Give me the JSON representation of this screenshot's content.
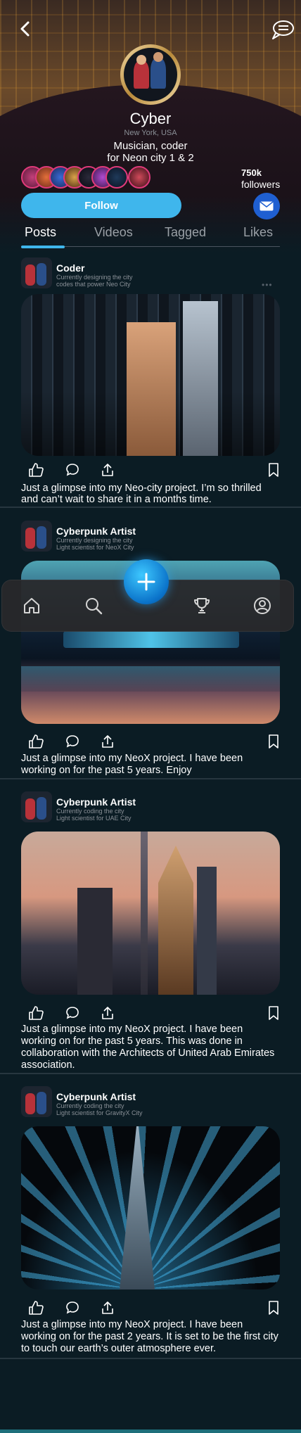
{
  "profile": {
    "name": "Cyber",
    "location": "New York, USA",
    "bio_line1": "Musician, coder",
    "bio_line2": "for Neon city 1 & 2",
    "followers_count": "750k",
    "followers_label": "followers",
    "follow_label": "Follow"
  },
  "tabs": [
    "Posts",
    "Videos",
    "Tagged",
    "Likes"
  ],
  "active_tab": "Posts",
  "posts": [
    {
      "title": "Coder",
      "sub1": "Currently designing the city",
      "sub2": "codes that power Neo City",
      "caption1": "Just a glimpse into my Neo-city project. I’m so thrilled",
      "caption2": "and can’t wait to share it in a months time."
    },
    {
      "title": "Cyberpunk Artist",
      "sub1": "Currently designing the city",
      "sub2": "Light scientist for NeoX City",
      "caption1": "Just a glimpse into my NeoX project. I have been",
      "caption2": "working on for the past 5 years. Enjoy"
    },
    {
      "title": "Cyberpunk Artist",
      "sub1": "Currently coding the city",
      "sub2": "Light scientist for UAE City",
      "caption1": "Just a glimpse into my NeoX project. I have been",
      "caption2": "working on for the past 5 years. This was done in",
      "caption3": "collaboration with the Architects of United Arab Emirates",
      "caption4": "association."
    },
    {
      "title": "Cyberpunk Artist",
      "sub1": "Currently coding the city",
      "sub2": "Light scientist for GravityX City",
      "caption1": "Just a glimpse into my NeoX project. I have been",
      "caption2": "working on for the past 2 years. It is set to be the first city",
      "caption3": "to touch our earth’s outer atmosphere ever."
    }
  ],
  "colors": {
    "accent": "#3fb6ec",
    "background": "#0b1c24",
    "mail": "#1f5fd1"
  },
  "icons": {
    "back": "chevron-left-icon",
    "chat": "chat-bubbles-icon",
    "home": "home-icon",
    "search": "search-icon",
    "trophy": "trophy-icon",
    "profile": "profile-icon",
    "add": "plus-icon"
  }
}
